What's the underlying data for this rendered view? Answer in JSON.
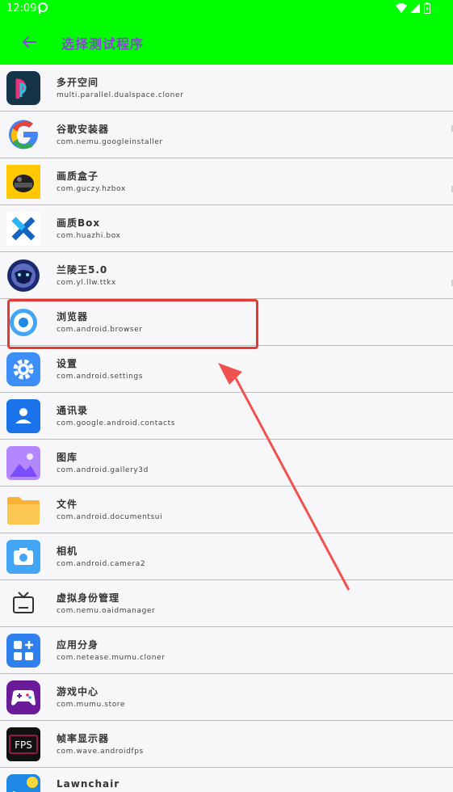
{
  "status": {
    "time": "12:09"
  },
  "app_bar": {
    "title": "选择测试程序"
  },
  "apps": [
    {
      "name": "多开空间",
      "package": "multi.parallel.dualspace.cloner",
      "icon": "dual-space-icon"
    },
    {
      "name": "谷歌安装器",
      "package": "com.nemu.googleinstaller",
      "icon": "google-icon"
    },
    {
      "name": "画质盒子",
      "package": "com.guczy.hzbox",
      "icon": "helmet-icon"
    },
    {
      "name": "画质Box",
      "package": "com.huazhi.box",
      "icon": "x-logo-icon"
    },
    {
      "name": "兰陵王5.0",
      "package": "com.yl.llw.ttkx",
      "icon": "mask-icon"
    },
    {
      "name": "浏览器",
      "package": "com.android.browser",
      "icon": "browser-icon"
    },
    {
      "name": "设置",
      "package": "com.android.settings",
      "icon": "settings-gear-icon"
    },
    {
      "name": "通讯录",
      "package": "com.google.android.contacts",
      "icon": "contacts-icon"
    },
    {
      "name": "图库",
      "package": "com.android.gallery3d",
      "icon": "gallery-icon"
    },
    {
      "name": "文件",
      "package": "com.android.documentsui",
      "icon": "folder-icon"
    },
    {
      "name": "相机",
      "package": "com.android.camera2",
      "icon": "camera-icon"
    },
    {
      "name": "虚拟身份管理",
      "package": "com.nemu.oaidmanager",
      "icon": "tv-icon"
    },
    {
      "name": "应用分身",
      "package": "com.netease.mumu.cloner",
      "icon": "app-clone-icon"
    },
    {
      "name": "游戏中心",
      "package": "com.mumu.store",
      "icon": "gamepad-icon"
    },
    {
      "name": "帧率显示器",
      "package": "com.wave.androidfps",
      "icon": "fps-icon"
    },
    {
      "name": "Lawnchair",
      "package": "",
      "icon": "lawnchair-icon"
    }
  ],
  "colors": {
    "accent": "#00ff00",
    "title": "#8b44d8",
    "highlight": "#e53935"
  }
}
